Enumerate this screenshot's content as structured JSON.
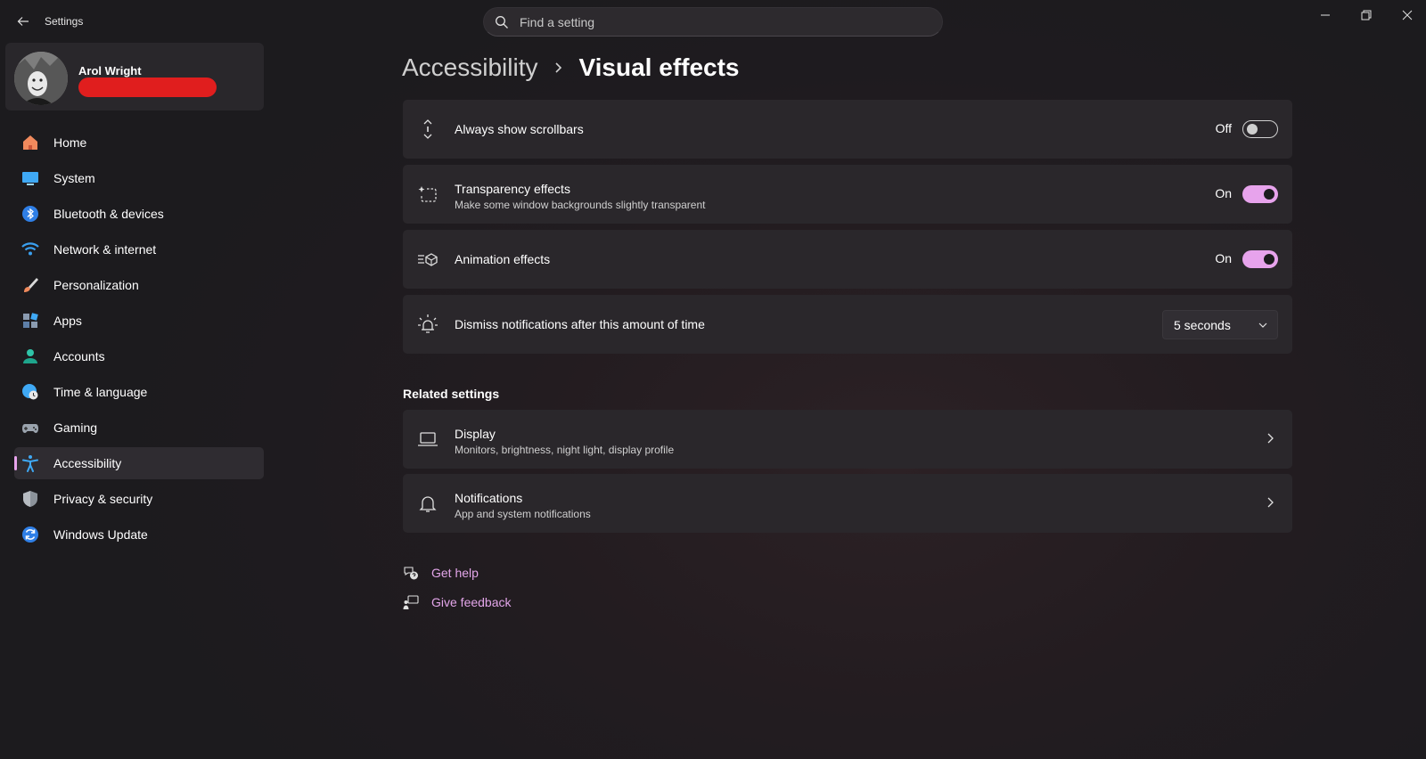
{
  "app": {
    "title": "Settings"
  },
  "search": {
    "placeholder": "Find a setting"
  },
  "profile": {
    "name": "Arol Wright"
  },
  "sidebar": {
    "items": [
      {
        "label": "Home"
      },
      {
        "label": "System"
      },
      {
        "label": "Bluetooth & devices"
      },
      {
        "label": "Network & internet"
      },
      {
        "label": "Personalization"
      },
      {
        "label": "Apps"
      },
      {
        "label": "Accounts"
      },
      {
        "label": "Time & language"
      },
      {
        "label": "Gaming"
      },
      {
        "label": "Accessibility"
      },
      {
        "label": "Privacy & security"
      },
      {
        "label": "Windows Update"
      }
    ],
    "active": "Accessibility"
  },
  "breadcrumb": {
    "parent": "Accessibility",
    "current": "Visual effects"
  },
  "settings": [
    {
      "title": "Always show scrollbars",
      "subtitle": "",
      "state": "Off",
      "icon": "scrollbar-icon"
    },
    {
      "title": "Transparency effects",
      "subtitle": "Make some window backgrounds slightly transparent",
      "state": "On",
      "icon": "transparency-icon"
    },
    {
      "title": "Animation effects",
      "subtitle": "",
      "state": "On",
      "icon": "animation-icon"
    },
    {
      "title": "Dismiss notifications after this amount of time",
      "subtitle": "",
      "value": "5 seconds",
      "icon": "notification-timer-icon"
    }
  ],
  "related": {
    "heading": "Related settings",
    "items": [
      {
        "title": "Display",
        "subtitle": "Monitors, brightness, night light, display profile",
        "icon": "laptop-icon"
      },
      {
        "title": "Notifications",
        "subtitle": "App and system notifications",
        "icon": "bell-icon"
      }
    ]
  },
  "links": {
    "help": "Get help",
    "feedback": "Give feedback"
  },
  "colors": {
    "accent": "#e7a3ec",
    "background": "#1e1b1f",
    "card": "#2a272b"
  }
}
